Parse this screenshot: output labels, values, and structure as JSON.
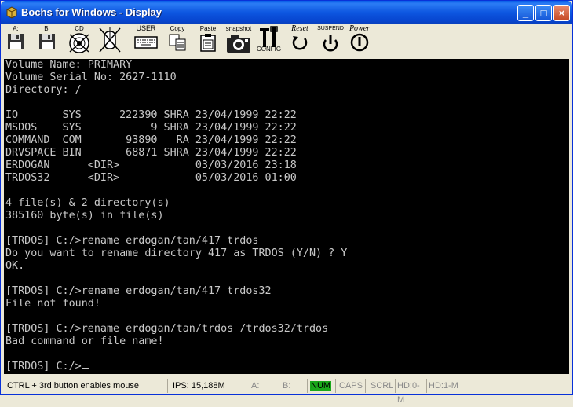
{
  "window": {
    "title": "Bochs for Windows - Display",
    "controls": {
      "minimize": "_",
      "maximize": "□",
      "close": "×"
    }
  },
  "toolbar": {
    "floppy_a": "A:",
    "floppy_b": "B:",
    "cdrom": "CD",
    "user": "USER",
    "copy": "Copy",
    "paste": "Paste",
    "snapshot": "snapshot",
    "config": "CONFIG",
    "reset": "Reset",
    "suspend": "SUSPEND",
    "power": "Power"
  },
  "terminal": {
    "lines": [
      "Volume Name: PRIMARY",
      "Volume Serial No: 2627-1110",
      "Directory: /",
      "",
      "IO       SYS      222390 SHRA 23/04/1999 22:22",
      "MSDOS    SYS           9 SHRA 23/04/1999 22:22",
      "COMMAND  COM       93890   RA 23/04/1999 22:22",
      "DRVSPACE BIN       68871 SHRA 23/04/1999 22:22",
      "ERDOGAN      <DIR>            03/03/2016 23:18",
      "TRDOS32      <DIR>            05/03/2016 01:00",
      "",
      "4 file(s) & 2 directory(s)",
      "385160 byte(s) in file(s)",
      "",
      "[TRDOS] C:/>rename erdogan/tan/417 trdos",
      "Do you want to rename directory 417 as TRDOS (Y/N) ? Y",
      "OK.",
      "",
      "[TRDOS] C:/>rename erdogan/tan/417 trdos32",
      "File not found!",
      "",
      "[TRDOS] C:/>rename erdogan/tan/trdos /trdos32/trdos",
      "Bad command or file name!",
      "",
      "[TRDOS] C:/>"
    ]
  },
  "statusbar": {
    "hint": "CTRL + 3rd button enables mouse",
    "ips": "IPS: 15,188M",
    "a": "A:",
    "b": "B:",
    "num": "NUM",
    "caps": "CAPS",
    "scrl": "SCRL",
    "hd0": "HD:0-M",
    "hd1": "HD:1-M"
  },
  "colors": {
    "num_indicator": "#1aa81a",
    "title_bar": "#0a5fe8",
    "terminal_bg": "#000000",
    "terminal_fg": "#c8c8c8"
  }
}
